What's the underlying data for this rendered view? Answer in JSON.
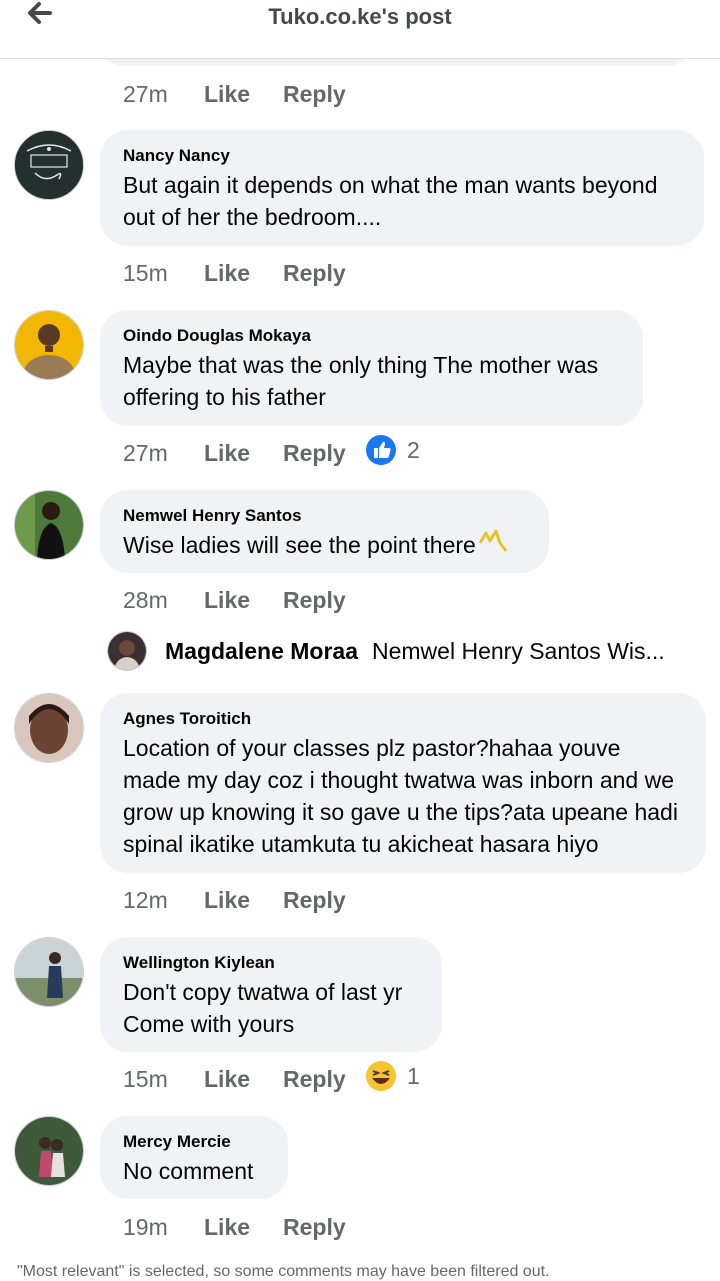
{
  "header": {
    "title": "Tuko.co.ke's post",
    "back_icon": "arrow-left-icon"
  },
  "labels": {
    "like": "Like",
    "reply": "Reply"
  },
  "top_actions": {
    "time": "27m"
  },
  "comments": [
    {
      "author": "Nancy Nancy",
      "text": "But again it depends on what the man wants beyond out of her the bedroom....",
      "time": "15m"
    },
    {
      "author": "Oindo Douglas Mokaya",
      "text": "Maybe that was the only thing The mother was offering to his father",
      "time": "27m",
      "reaction": {
        "icon": "thumbs-up-icon",
        "count": "2"
      }
    },
    {
      "author": "Nemwel Henry Santos",
      "text": "Wise ladies will see the point there",
      "time": "28m"
    },
    {
      "author": "Agnes Toroitich",
      "text": "Location of your classes plz pastor?hahaa youve made my day coz i thought twatwa was inborn and we grow up knowing it so gave u the tips?ata upeane hadi spinal ikatike utamkuta tu akicheat hasara hiyo",
      "time": "12m"
    },
    {
      "author": "Wellington Kiylean",
      "text": "Don't copy twatwa of last yr Come with yours",
      "time": "15m",
      "reaction": {
        "icon": "laughing-face-icon",
        "count": "1"
      }
    },
    {
      "author": "Mercy Mercie",
      "text": "No comment",
      "time": "19m"
    }
  ],
  "nested_reply": {
    "author": "Magdalene Moraa",
    "preview": "Nemwel Henry Santos Wis..."
  },
  "footer": {
    "note": "\"Most relevant\" is selected, so some comments may have been filtered out."
  },
  "colors": {
    "bubble": "#f0f2f5",
    "meta_text": "#65676b",
    "like_blue": "#1877f2"
  }
}
